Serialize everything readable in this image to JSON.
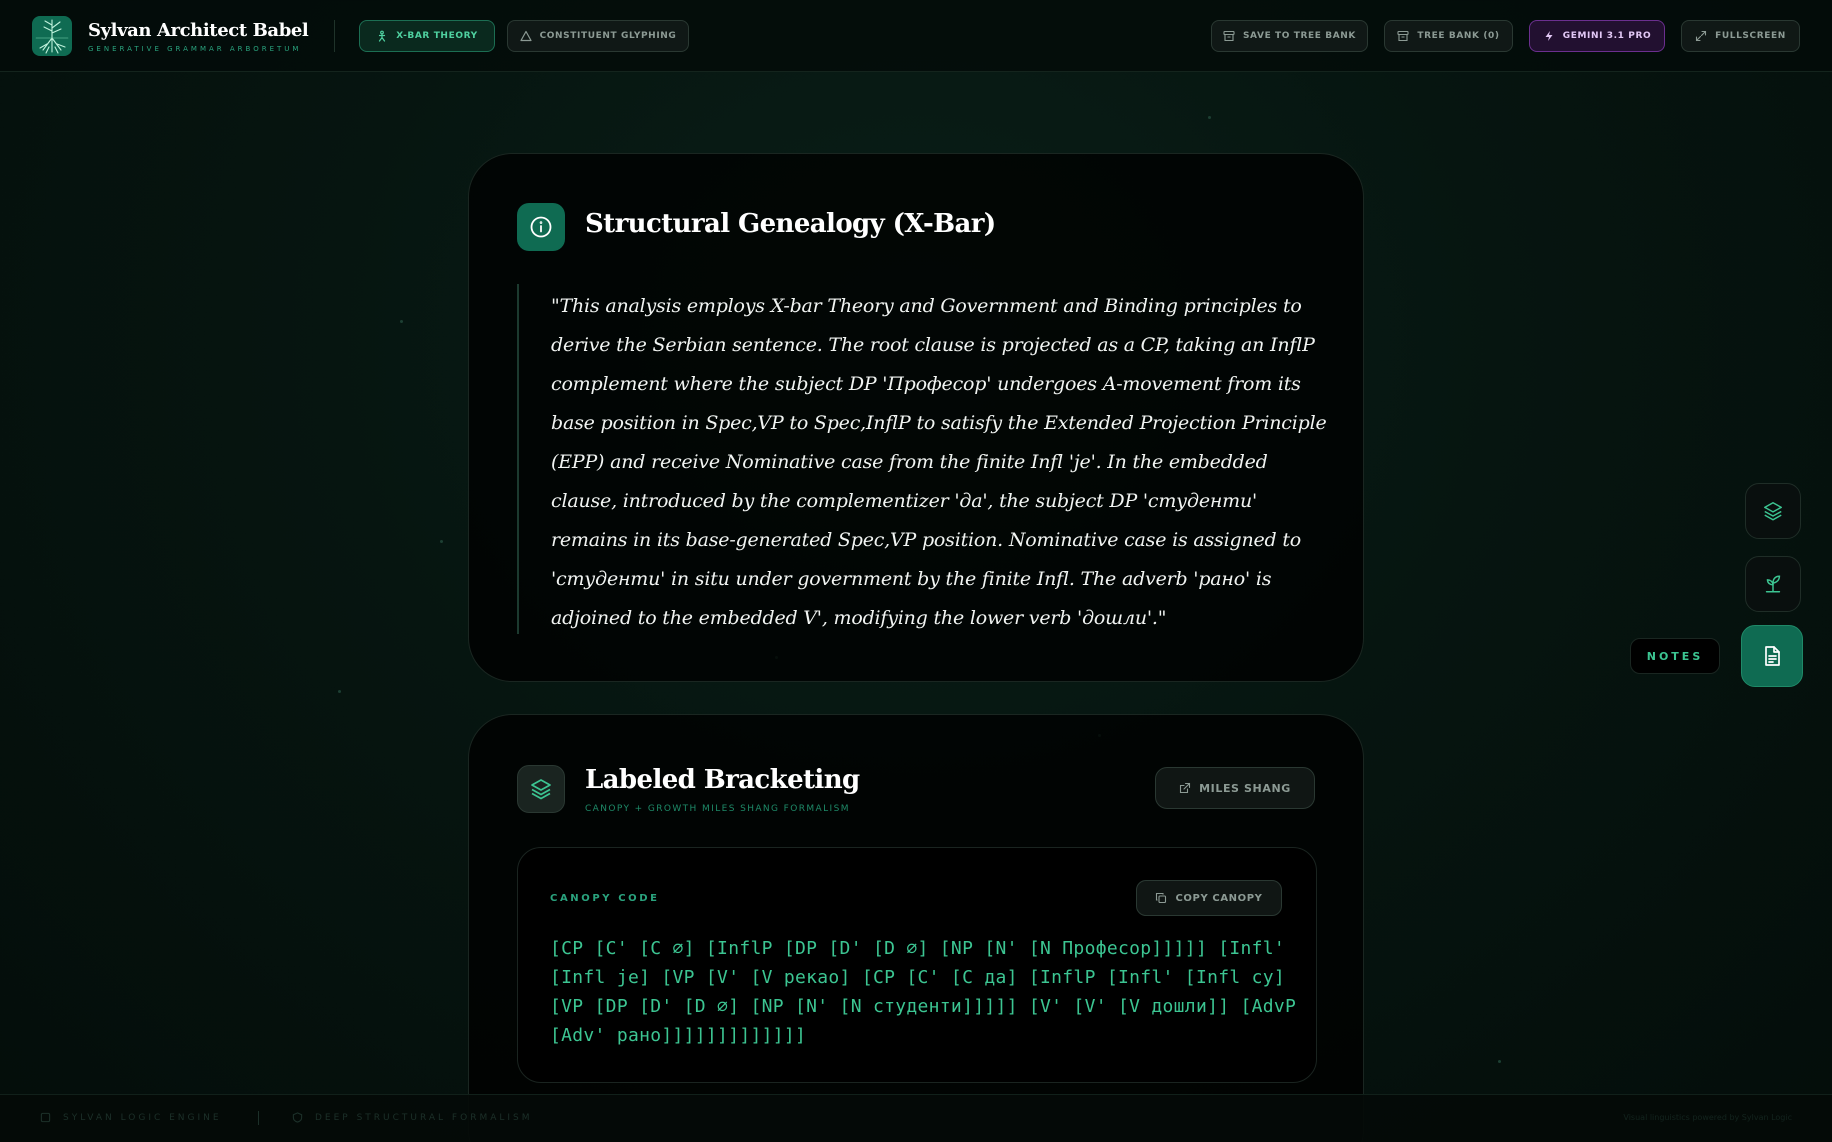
{
  "header": {
    "brand_title": "Sylvan Architect Babel",
    "brand_subtitle": "GENERATIVE GRAMMAR ARBORETUM",
    "modes": [
      {
        "label": "X-BAR THEORY",
        "active": true
      },
      {
        "label": "CONSTITUENT GLYPHING",
        "active": false
      }
    ],
    "actions": {
      "save": "SAVE TO TREE BANK",
      "tree_bank": "TREE BANK (0)",
      "model": "GEMINI 3.1 PRO",
      "fullscreen": "FULLSCREEN"
    }
  },
  "genealogy": {
    "title": "Structural Genealogy (X-Bar)",
    "text": "\"This analysis employs X-bar Theory and Government and Binding principles to derive the Serbian sentence. The root clause is projected as a CP, taking an InflP complement where the subject DP 'Професор' undergoes A-movement from its base position in Spec,VP to Spec,InflP to satisfy the Extended Projection Principle (EPP) and receive Nominative case from the finite Infl 'је'. In the embedded clause, introduced by the complementizer 'да', the subject DP 'студенти' remains in its base-generated Spec,VP position. Nominative case is assigned to 'студенти' in situ under government by the finite Infl. The adverb 'рано' is adjoined to the embedded V', modifying the lower verb 'дошли'.\""
  },
  "bracketing": {
    "title": "Labeled Bracketing",
    "subtitle": "CANOPY + GROWTH MILES SHANG FORMALISM",
    "miles_button": "MILES SHANG",
    "code_label": "CANOPY CODE",
    "copy_button": "COPY CANOPY",
    "code": "[CP [C' [C ∅] [InflP [DP [D' [D ∅] [NP [N' [N Професор]]]]] [Infl' [Infl је] [VP [V' [V рекао] [CP [C' [C да] [InflP [Infl' [Infl су] [VP [DP [D' [D ∅] [NP [N' [N студенти]]]]] [V' [V' [V дошли]] [AdvP [Adv' рано]]]]]]]]]]]]]"
  },
  "side_panel": {
    "notes_label": "NOTES"
  },
  "footer": {
    "left": "SYLVAN LOGIC ENGINE",
    "center": "DEEP STRUCTURAL FORMALISM",
    "right": "Visual linguistics powered by Sylvan Logic"
  },
  "colors": {
    "accent": "#3cc592",
    "brand_green": "#0f6b52",
    "model_purple": "#6b2f8f",
    "background": "#061510"
  }
}
